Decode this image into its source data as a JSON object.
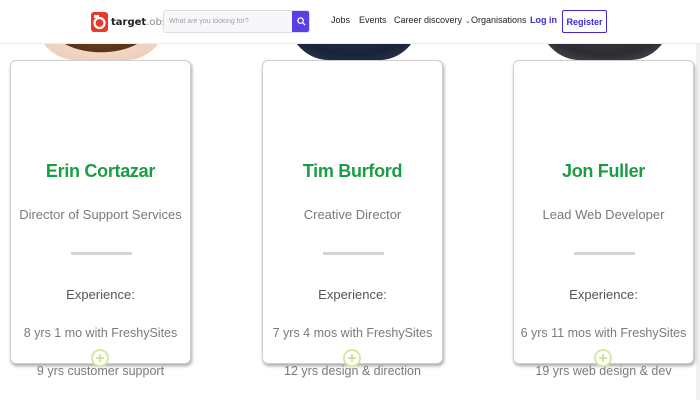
{
  "nav": {
    "logo_bold": "target",
    "logo_light": ".obs",
    "search_placeholder": "What are you looking for?",
    "links": [
      "Jobs",
      "Events",
      "Career discovery",
      "Organisations"
    ],
    "login": "Log in",
    "register": "Register",
    "icons": {
      "search": "search-icon",
      "dropdown": "chevron-down-icon"
    }
  },
  "team": [
    {
      "name": "Erin Cortazar",
      "role": "Director of Support Services",
      "experience_label": "Experience:",
      "experience": [
        "8 yrs 1 mo with FreshySites",
        "9 yrs customer support"
      ]
    },
    {
      "name": "Tim Burford",
      "role": "Creative Director",
      "experience_label": "Experience:",
      "experience": [
        "7 yrs 4 mos with FreshySites",
        "12 yrs design & direction"
      ]
    },
    {
      "name": "Jon Fuller",
      "role": "Lead Web Developer",
      "experience_label": "Experience:",
      "experience": [
        "6 yrs 11 mos with FreshySites",
        "19 yrs web design & dev"
      ]
    }
  ],
  "colors": {
    "accent": "#5b3fe6",
    "link": "#3b2bd6",
    "name_green": "#1b9e43",
    "expand_ring": "#d6e8a4"
  }
}
